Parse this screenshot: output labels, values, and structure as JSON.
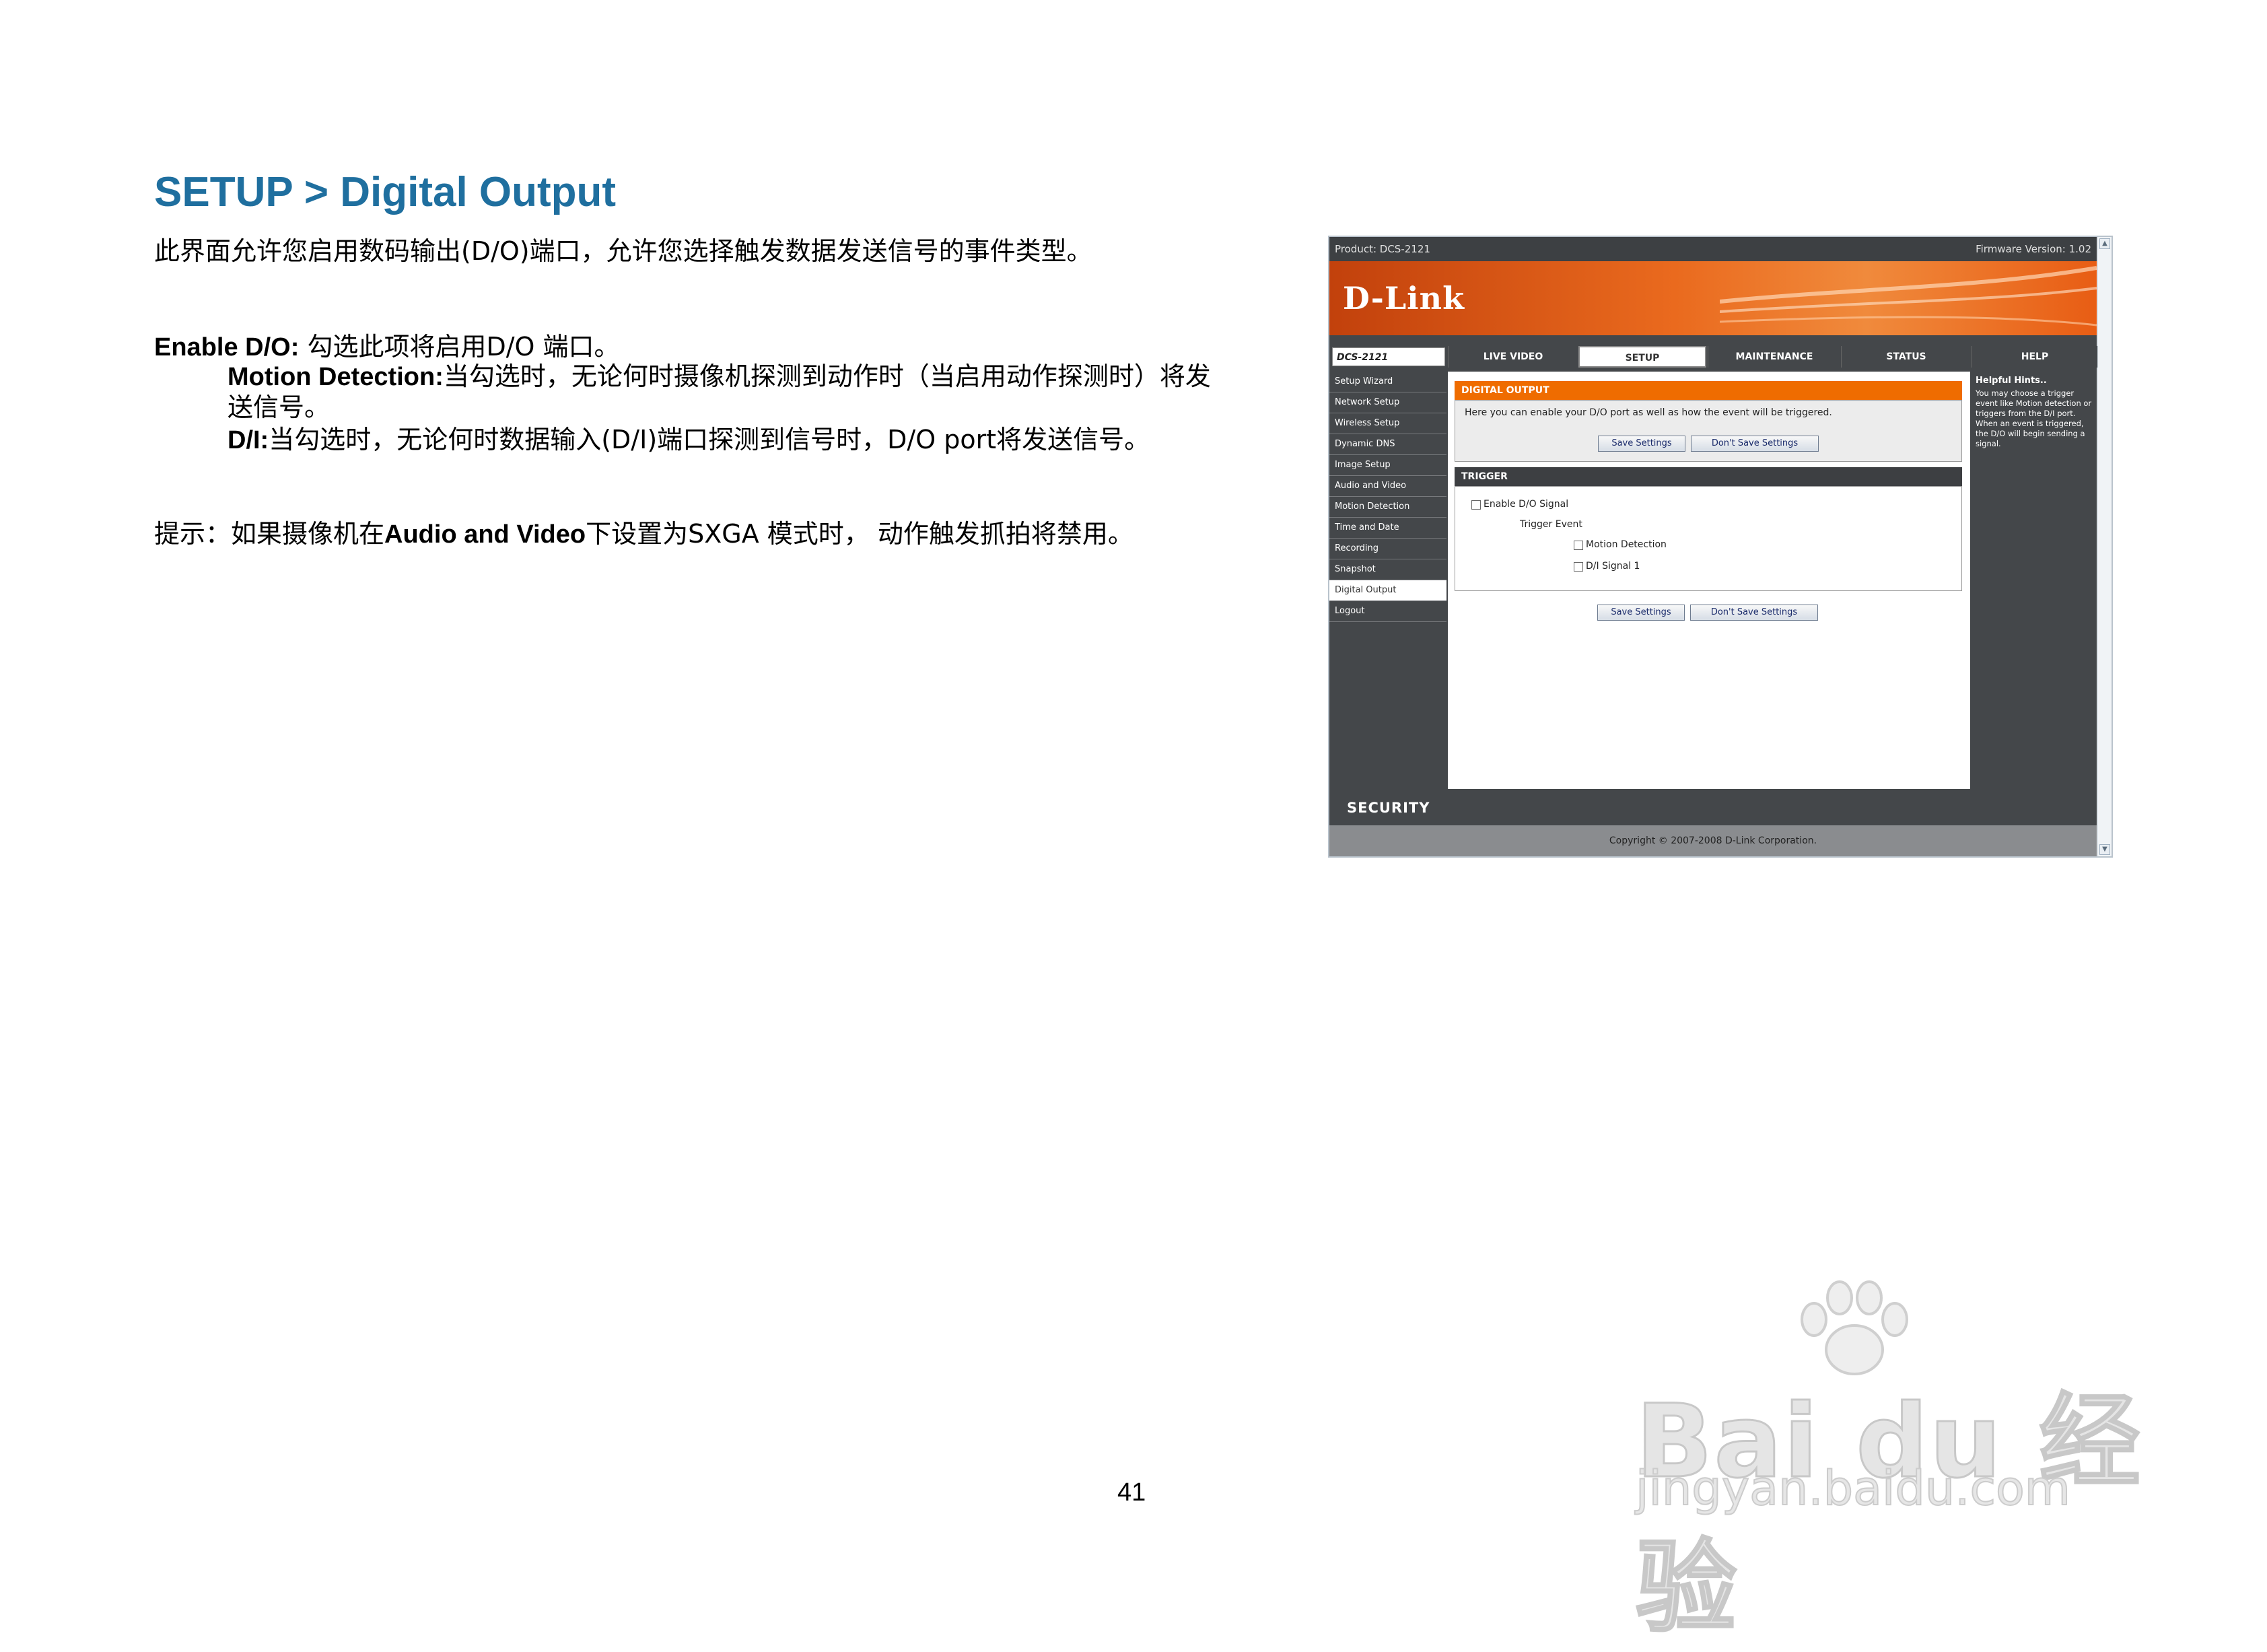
{
  "doc": {
    "title": "SETUP > Digital Output",
    "intro": "此界面允许您启用数码输出(D/O)端口，允许您选择触发数据发送信号的事件类型。",
    "enable_label": "Enable D/O:",
    "enable_text": " 勾选此项将启用D/O 端口。",
    "motion_label": "Motion Detection:",
    "motion_text": "当勾选时，无论何时摄像机探测到动作时（当启用动作探测时）将发",
    "motion_text2": "送信号。",
    "di_label": "D/I:",
    "di_text": "当勾选时，无论何时数据输入(D/I)端口探测到信号时，D/O port将发送信号。",
    "tip_prefix": "提示：如果摄像机在",
    "tip_bold": "Audio and Video",
    "tip_suffix": "下设置为SXGA 模式时， 动作触发抓拍将禁用。",
    "page_number": "41"
  },
  "screenshot": {
    "product": "Product: DCS-2121",
    "firmware": "Firmware Version: 1.02",
    "logo": "D-Link",
    "model_tab": "DCS-2121",
    "nav_tabs": [
      "LIVE VIDEO",
      "SETUP",
      "MAINTENANCE",
      "STATUS",
      "HELP"
    ],
    "active_tab": "SETUP",
    "sidebar": [
      "Setup Wizard",
      "Network Setup",
      "Wireless Setup",
      "Dynamic DNS",
      "Image Setup",
      "Audio and Video",
      "Motion Detection",
      "Time and Date",
      "Recording",
      "Snapshot",
      "Digital Output",
      "Logout"
    ],
    "active_sidebar": "Digital Output",
    "do_header": "DIGITAL OUTPUT",
    "do_desc": "Here you can enable your D/O port as well as how the event will be triggered.",
    "save_label": "Save Settings",
    "dont_save_label": "Don't Save Settings",
    "trigger_header": "TRIGGER",
    "enable_signal": "Enable D/O Signal",
    "trigger_event": "Trigger Event",
    "motion_detection": "Motion Detection",
    "di_signal": "D/I Signal 1",
    "hints_title": "Helpful Hints..",
    "hints_body": "You may choose a trigger event like Motion detection or triggers from the D/I port. When an event is triggered, the D/O will begin sending a signal.",
    "security": "SECURITY",
    "copyright": "Copyright © 2007-2008 D-Link Corporation."
  },
  "watermark": {
    "main": "Bai du 经验",
    "sub": "jingyan.baidu.com"
  }
}
